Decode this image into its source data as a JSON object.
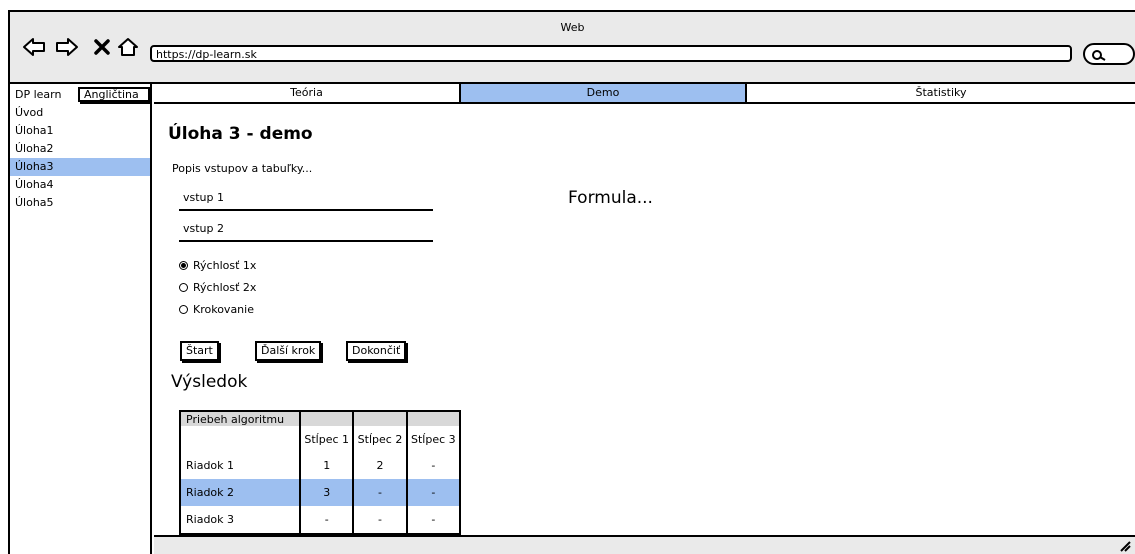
{
  "window": {
    "title": "Web"
  },
  "browser": {
    "url": "https://dp-learn.sk",
    "icons": [
      "back-arrow-icon",
      "forward-arrow-icon",
      "close-icon",
      "home-icon",
      "search-icon"
    ]
  },
  "sidebar": {
    "brand": "DP learn",
    "language": "Angličtina",
    "items": [
      {
        "label": "Úvod",
        "active": false
      },
      {
        "label": "Úloha1",
        "active": false
      },
      {
        "label": "Úloha2",
        "active": false
      },
      {
        "label": "Úloha3",
        "active": true
      },
      {
        "label": "Úloha4",
        "active": false
      },
      {
        "label": "Úloha5",
        "active": false
      }
    ]
  },
  "tabs": [
    {
      "label": "Teória",
      "active": false
    },
    {
      "label": "Demo",
      "active": true
    },
    {
      "label": "Štatistiky",
      "active": false
    }
  ],
  "main": {
    "title": "Úloha 3 - demo",
    "description": "Popis vstupov a tabuľky...",
    "inputs": [
      {
        "value": "vstup 1"
      },
      {
        "value": "vstup 2"
      }
    ],
    "formula": "Formula...",
    "radios": [
      {
        "label": "Rýchlosť 1x",
        "checked": true
      },
      {
        "label": "Rýchlosť 2x",
        "checked": false
      },
      {
        "label": "Krokovanie",
        "checked": false
      }
    ],
    "buttons": {
      "start": "Štart",
      "next": "Ďalší krok",
      "finish": "Dokončiť"
    },
    "result_title": "Výsledok",
    "table": {
      "caption": "Priebeh algoritmu",
      "columns": [
        "Stĺpec 1",
        "Stĺpec 2",
        "Stĺpec 3"
      ],
      "rows": [
        {
          "label": "Riadok 1",
          "cells": [
            "1",
            "2",
            "-"
          ],
          "active": false
        },
        {
          "label": "Riadok 2",
          "cells": [
            "3",
            "-",
            "-"
          ],
          "active": true
        },
        {
          "label": "Riadok 3",
          "cells": [
            "-",
            "-",
            "-"
          ],
          "active": false
        }
      ]
    }
  },
  "colors": {
    "highlight": "#9dbff0",
    "chrome": "#eaeaea",
    "border": "#000000"
  }
}
